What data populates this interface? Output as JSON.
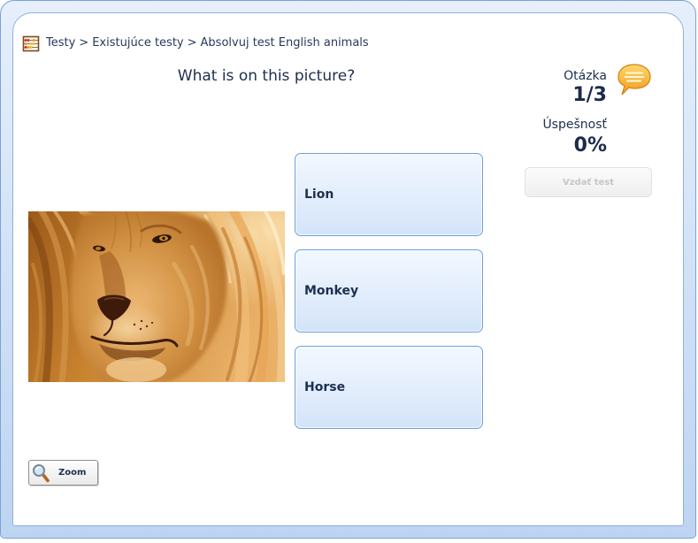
{
  "breadcrumb": {
    "items": [
      {
        "label": "Testy"
      },
      {
        "label": "Existujúce testy"
      },
      {
        "label": "Absolvuj test English animals"
      }
    ],
    "separator": ">"
  },
  "question": {
    "text": "What is on this picture?"
  },
  "answers": [
    {
      "label": "Lion"
    },
    {
      "label": "Monkey"
    },
    {
      "label": "Horse"
    }
  ],
  "status": {
    "question_label": "Otázka",
    "question_value": "1/3",
    "success_label": "Úspešnosť",
    "success_value": "0%"
  },
  "actions": {
    "give_up_label": "Vzdať test",
    "zoom_label": "Zoom"
  },
  "icons": {
    "breadcrumb": "abacus-icon",
    "hint": "speech-bubble-icon",
    "zoom": "magnifier-icon"
  },
  "colors": {
    "accent": "#6b9fd9",
    "text": "#1e2f4f",
    "frame": "#cfe0f6",
    "disabled": "#c6c6c6"
  }
}
